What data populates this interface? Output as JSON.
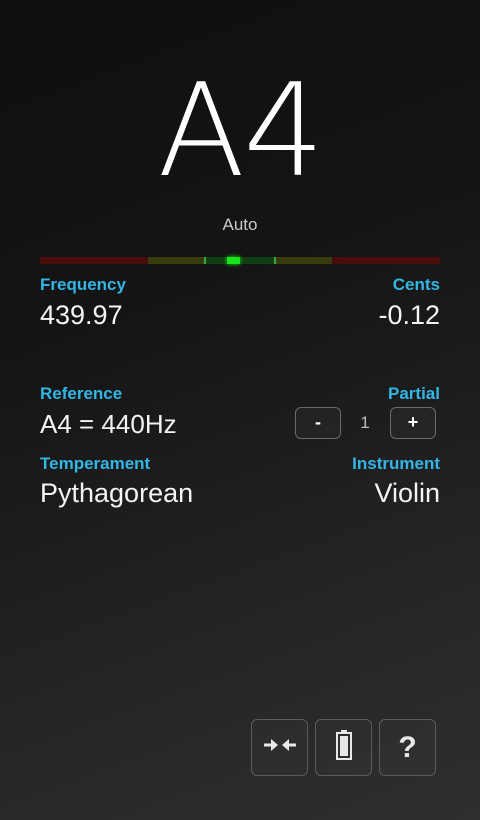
{
  "tuner": {
    "note": "A4",
    "mode": "Auto"
  },
  "meter": {
    "cents": -0.12,
    "colors": {
      "flat_far": "#4a0d0d",
      "near": "#3b3b10",
      "center": "#0f3f12",
      "needle": "#19e619",
      "sharp_far": "#4a0d0d"
    }
  },
  "frequency": {
    "label": "Frequency",
    "value": "439.97"
  },
  "cents": {
    "label": "Cents",
    "value": "-0.12"
  },
  "reference": {
    "label": "Reference",
    "value": "A4 = 440Hz"
  },
  "partial": {
    "label": "Partial",
    "minus_label": "-",
    "value": "1",
    "plus_label": "+"
  },
  "temperament": {
    "label": "Temperament",
    "value": "Pythagorean"
  },
  "instrument": {
    "label": "Instrument",
    "value": "Violin"
  },
  "toolbar": {
    "buttons": [
      {
        "icon": "collapse-arrows-icon"
      },
      {
        "icon": "battery-icon"
      },
      {
        "icon": "help-icon",
        "label": "?"
      }
    ]
  },
  "accent_color": "#33b5e5"
}
